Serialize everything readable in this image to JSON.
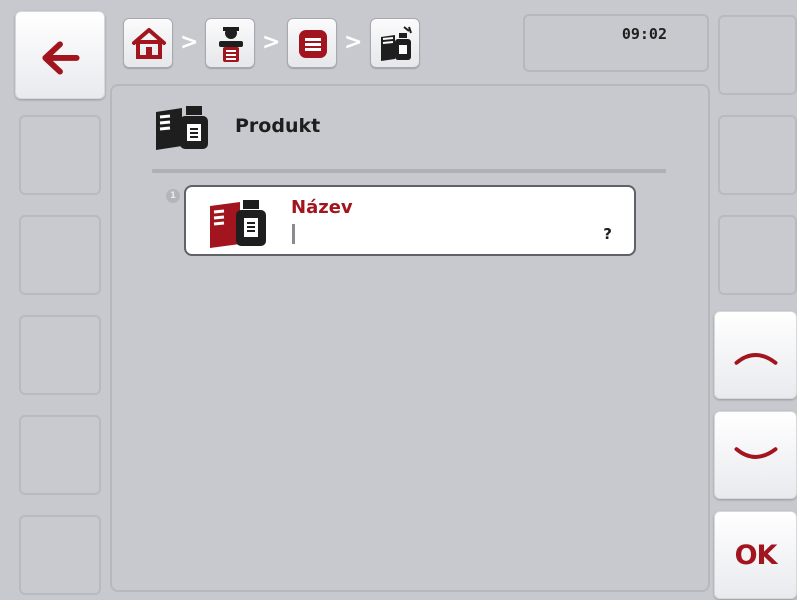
{
  "header": {
    "breadcrumb": [
      {
        "icon": "home-icon"
      },
      {
        "icon": "customer-icon"
      },
      {
        "icon": "list-icon"
      },
      {
        "icon": "product-icon"
      }
    ],
    "separator": ">",
    "clock": "09:02"
  },
  "page": {
    "title": "Produkt",
    "title_icon": "product-icon"
  },
  "entries": [
    {
      "index": "1",
      "label": "Název",
      "value": "",
      "help": "?",
      "icon": "product-icon"
    }
  ],
  "buttons": {
    "back_icon": "arrow-left-icon",
    "scroll_up_icon": "chevron-up-icon",
    "scroll_down_icon": "chevron-down-icon",
    "ok_label": "OK"
  },
  "colors": {
    "background": "#c8c9ce",
    "accent": "#a2141e"
  }
}
